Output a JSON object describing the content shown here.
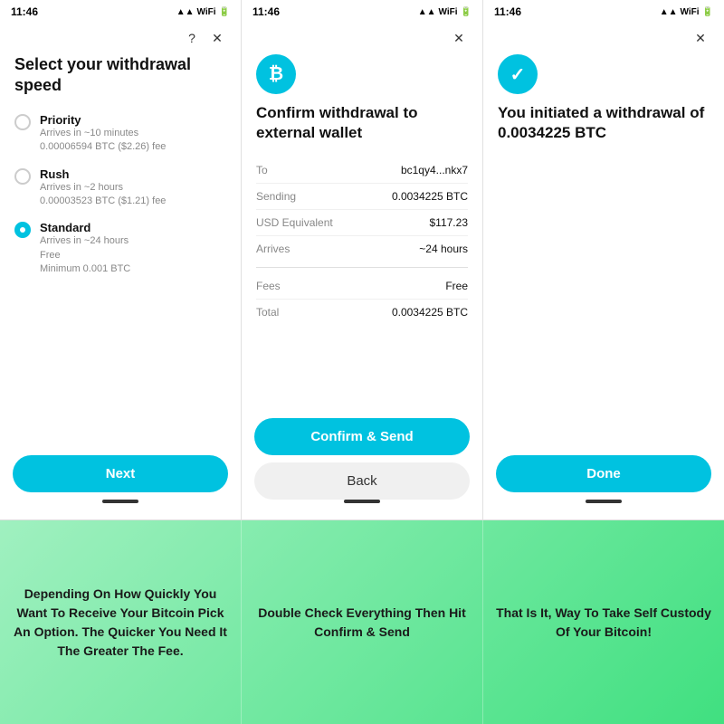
{
  "screens": [
    {
      "id": "screen1",
      "statusTime": "11:46",
      "title": "Select your withdrawal speed",
      "options": [
        {
          "id": "priority",
          "label": "Priority",
          "desc1": "Arrives in ~10 minutes",
          "desc2": "0.00006594 BTC ($2.26) fee",
          "selected": false
        },
        {
          "id": "rush",
          "label": "Rush",
          "desc1": "Arrives in ~2 hours",
          "desc2": "0.00003523 BTC ($1.21) fee",
          "selected": false
        },
        {
          "id": "standard",
          "label": "Standard",
          "desc1": "Arrives in ~24 hours",
          "desc2": "Free",
          "desc3": "Minimum 0.001 BTC",
          "selected": true
        }
      ],
      "nextButton": "Next"
    },
    {
      "id": "screen2",
      "statusTime": "11:46",
      "title": "Confirm withdrawal to external wallet",
      "details": [
        {
          "label": "To",
          "value": "bc1qy4...nkx7"
        },
        {
          "label": "Sending",
          "value": "0.0034225 BTC"
        },
        {
          "label": "USD Equivalent",
          "value": "$117.23"
        },
        {
          "label": "Arrives",
          "value": "~24 hours"
        }
      ],
      "feesRow": [
        {
          "label": "Fees",
          "value": "Free"
        },
        {
          "label": "Total",
          "value": "0.0034225 BTC"
        }
      ],
      "confirmButton": "Confirm & Send",
      "backButton": "Back"
    },
    {
      "id": "screen3",
      "statusTime": "11:46",
      "title": "You initiated a withdrawal of 0.0034225 BTC",
      "doneButton": "Done"
    }
  ],
  "captions": [
    "Depending On How Quickly You Want To Receive Your Bitcoin Pick An Option. The Quicker You Need It The Greater The Fee.",
    "Double Check Everything Then Hit Confirm & Send",
    "That Is It, Way To Take Self Custody Of Your Bitcoin!"
  ]
}
